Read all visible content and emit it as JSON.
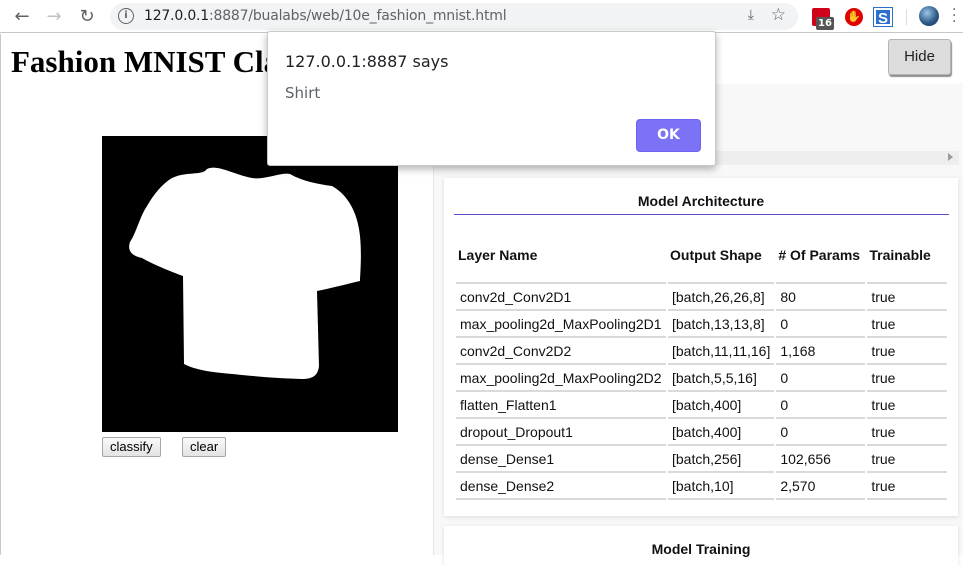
{
  "browser": {
    "back_icon": "arrow-left-icon",
    "forward_icon": "arrow-right-icon",
    "reload_icon": "reload-icon",
    "url_host": "127.0.0.1",
    "url_rest": ":8887/bualabs/web/10e_fashion_mnist.html",
    "extension_badge": "16",
    "extensions": [
      "extension-red-icon",
      "stop-hand-icon",
      "s-extension-icon"
    ]
  },
  "page": {
    "title": "Fashion MNIST Classifier",
    "canvas_label": "drawing-canvas",
    "classify_label": "classify",
    "clear_label": "clear"
  },
  "visor": {
    "hide_label": "Hide"
  },
  "model_architecture": {
    "title": "Model Architecture",
    "columns": [
      "Layer Name",
      "Output Shape",
      "# Of Params",
      "Trainable"
    ],
    "rows": [
      [
        "conv2d_Conv2D1",
        "[batch,26,26,8]",
        "80",
        "true"
      ],
      [
        "max_pooling2d_MaxPooling2D1",
        "[batch,13,13,8]",
        "0",
        "true"
      ],
      [
        "conv2d_Conv2D2",
        "[batch,11,11,16]",
        "1,168",
        "true"
      ],
      [
        "max_pooling2d_MaxPooling2D2",
        "[batch,5,5,16]",
        "0",
        "true"
      ],
      [
        "flatten_Flatten1",
        "[batch,400]",
        "0",
        "true"
      ],
      [
        "dropout_Dropout1",
        "[batch,400]",
        "0",
        "true"
      ],
      [
        "dense_Dense1",
        "[batch,256]",
        "102,656",
        "true"
      ],
      [
        "dense_Dense2",
        "[batch,10]",
        "2,570",
        "true"
      ]
    ]
  },
  "model_training": {
    "title": "Model Training"
  },
  "alert_dialog": {
    "title": "127.0.0.1:8887 says",
    "message": "Shirt",
    "ok_label": "OK",
    "accent_color": "#7b72f6"
  }
}
